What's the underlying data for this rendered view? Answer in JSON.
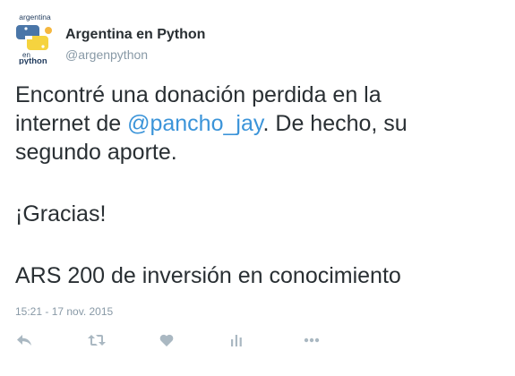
{
  "account": {
    "name": "Argentina en Python",
    "handle": "@argenpython",
    "avatar_text_top": "argentina",
    "avatar_text_en": "en",
    "avatar_text_python": "python"
  },
  "tweet": {
    "line1": "Encontré una donación perdida en la",
    "line2_before": "internet de ",
    "mention": "@pancho_jay",
    "line2_after": ". De hecho, su",
    "line3": "segundo aporte.",
    "thanks": "¡Gracias!",
    "closing": "ARS 200 de inversión en conocimiento",
    "timestamp": "15:21 - 17 nov. 2015"
  },
  "actions": {
    "reply_icon": "reply-icon",
    "retweet_icon": "retweet-icon",
    "like_icon": "heart-icon",
    "analytics_icon": "analytics-icon",
    "more_icon": "more-icon"
  },
  "colors": {
    "text": "#292f33",
    "secondary": "#8899a6",
    "link": "#3b94d9",
    "icon": "#aab8c2"
  }
}
